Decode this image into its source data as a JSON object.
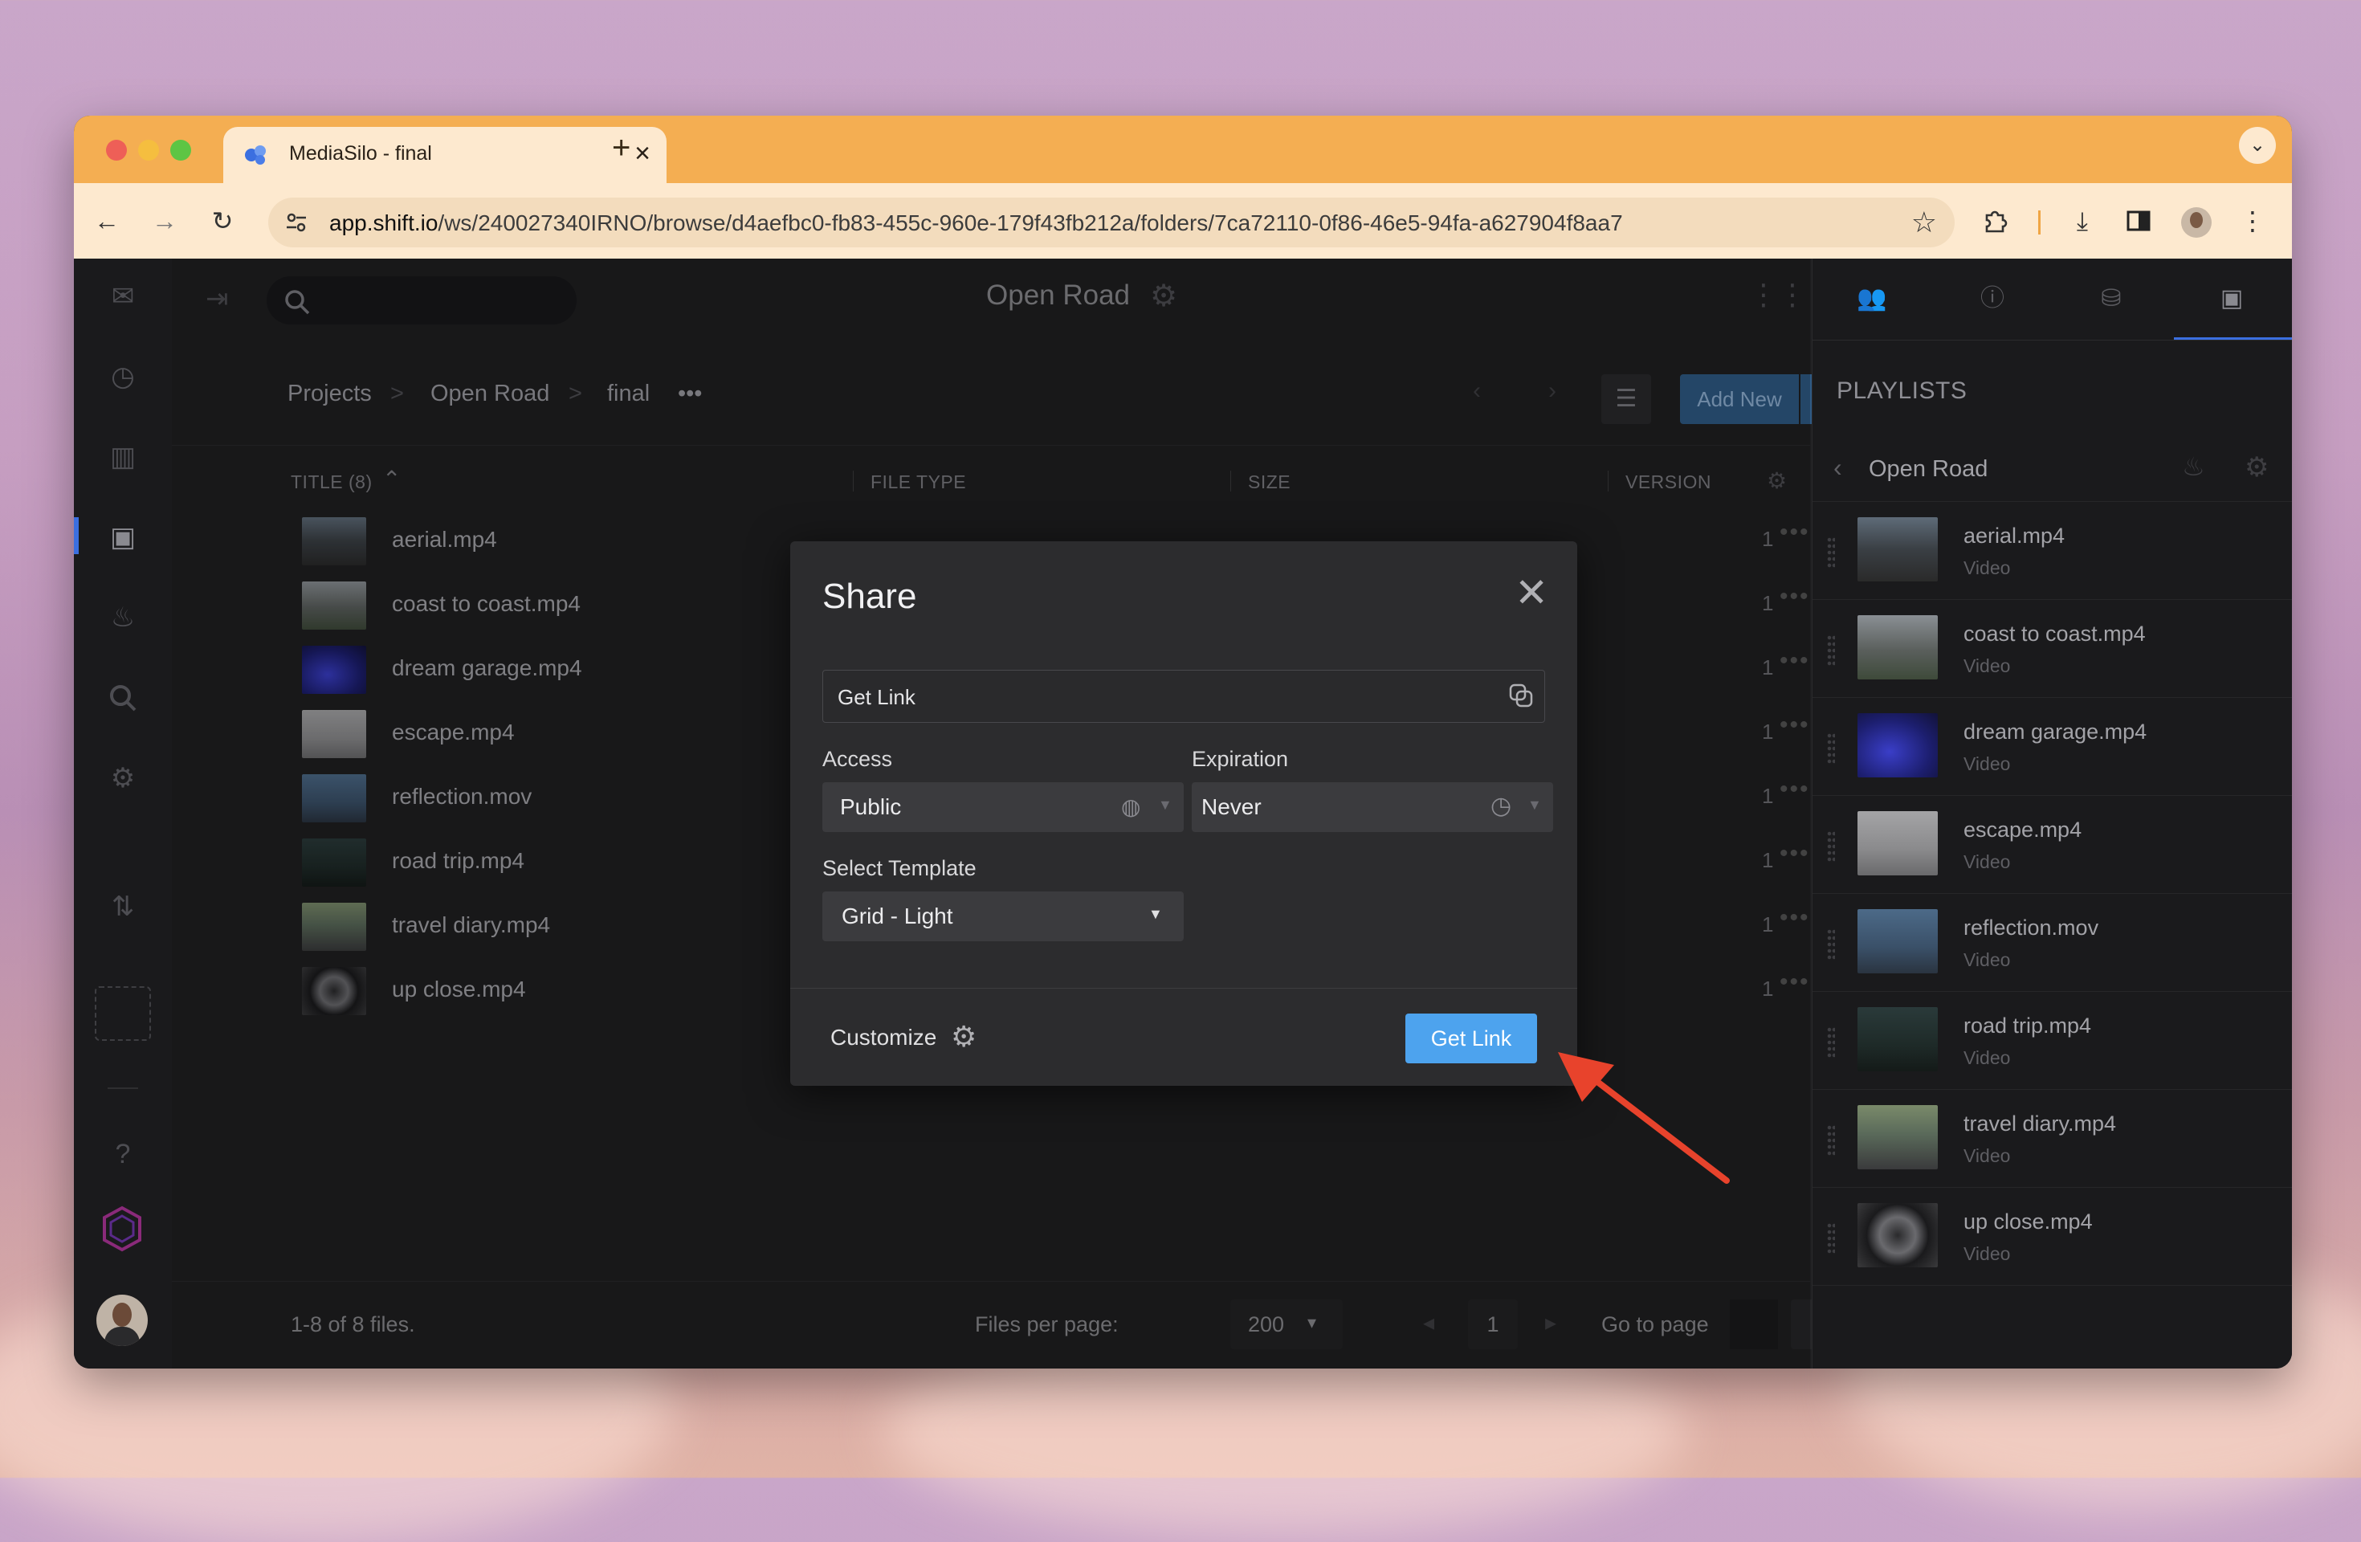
{
  "browser": {
    "tab_title": "MediaSilo - final",
    "tab_close": "×",
    "new_tab": "+",
    "url_host": "app.shift.io",
    "url_path": "/ws/240027340IRNO/browse/d4aefbc0-fb83-455c-960e-179f43fb212a/folders/7ca72110-0f86-46e5-94fa-a627904f8aa7"
  },
  "header": {
    "project_title": "Open Road"
  },
  "breadcrumb": {
    "items": [
      "Projects",
      "Open Road",
      "final"
    ],
    "separator": ">",
    "more": "•••"
  },
  "toolbar": {
    "add_new_label": "Add New"
  },
  "table": {
    "columns": [
      "TITLE (8)",
      "FILE TYPE",
      "SIZE",
      "VERSION"
    ],
    "rows": [
      {
        "name": "aerial.mp4",
        "version": "1"
      },
      {
        "name": "coast to coast.mp4",
        "version": "1"
      },
      {
        "name": "dream garage.mp4",
        "version": "1"
      },
      {
        "name": "escape.mp4",
        "version": "1"
      },
      {
        "name": "reflection.mov",
        "version": "1"
      },
      {
        "name": "road trip.mp4",
        "version": "1"
      },
      {
        "name": "travel diary.mp4",
        "version": "1"
      },
      {
        "name": "up close.mp4",
        "version": "1"
      }
    ],
    "row_more": "•••"
  },
  "footer": {
    "count_text": "1-8 of 8 files.",
    "files_per_page_label": "Files per page:",
    "files_per_page_value": "200",
    "current_page": "1",
    "go_to_page_label": "Go to page"
  },
  "share_modal": {
    "title": "Share",
    "close": "✕",
    "link_placeholder": "Get Link",
    "access_label": "Access",
    "access_value": "Public",
    "expiration_label": "Expiration",
    "expiration_value": "Never",
    "template_label": "Select Template",
    "template_value": "Grid - Light",
    "customize_label": "Customize",
    "get_link_button": "Get Link"
  },
  "playlists": {
    "heading": "PLAYLISTS",
    "current": "Open Road",
    "items": [
      {
        "name": "aerial.mp4",
        "type": "Video"
      },
      {
        "name": "coast to coast.mp4",
        "type": "Video"
      },
      {
        "name": "dream garage.mp4",
        "type": "Video"
      },
      {
        "name": "escape.mp4",
        "type": "Video"
      },
      {
        "name": "reflection.mov",
        "type": "Video"
      },
      {
        "name": "road trip.mp4",
        "type": "Video"
      },
      {
        "name": "travel diary.mp4",
        "type": "Video"
      },
      {
        "name": "up close.mp4",
        "type": "Video"
      }
    ]
  },
  "colors": {
    "tab_bar": "#f4ae52",
    "toolbar": "#fde9cf",
    "primary_button": "#4da3ee",
    "annotation_arrow": "#e8432c"
  },
  "icons": {
    "rail": [
      "inbox-icon",
      "clock-icon",
      "chart-icon",
      "archive-icon",
      "fire-icon",
      "search-icon",
      "settings-icon",
      "sort-icon",
      "dashed-box-icon",
      "help-icon",
      "logo-icon",
      "avatar"
    ],
    "right_tabs": [
      "users-icon",
      "info-icon",
      "database-icon",
      "playlist-icon"
    ]
  }
}
